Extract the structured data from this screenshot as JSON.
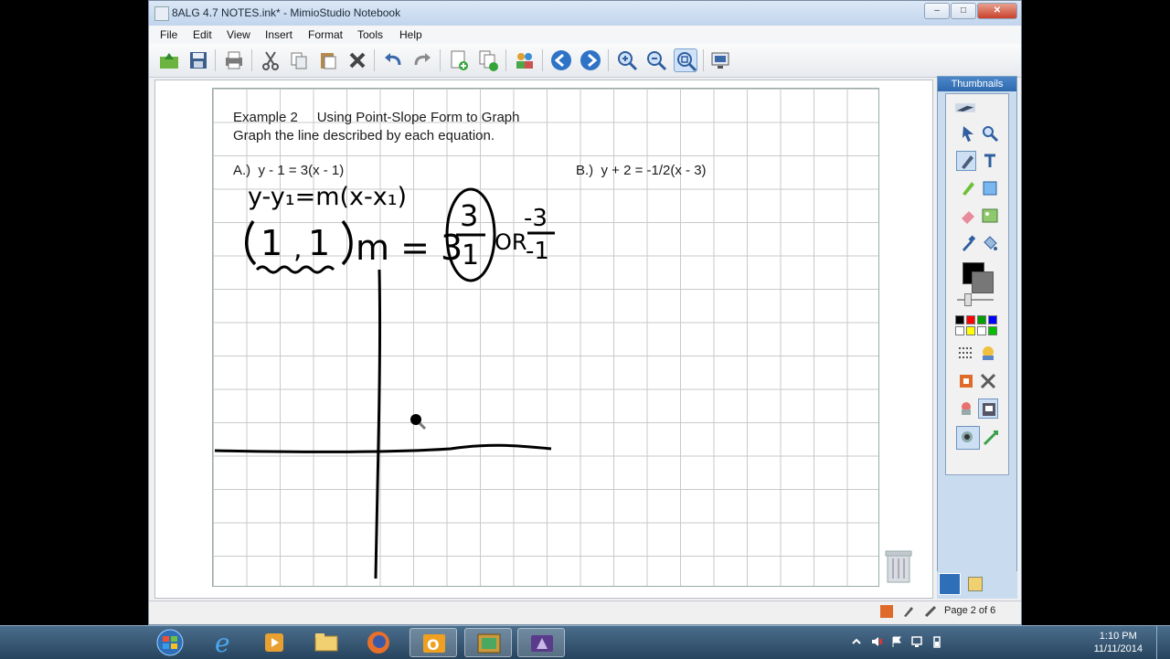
{
  "window": {
    "title": "8ALG 4.7 NOTES.ink* - MimioStudio Notebook",
    "controls": [
      "–",
      "□",
      "✕"
    ]
  },
  "menu": [
    "File",
    "Edit",
    "View",
    "Insert",
    "Format",
    "Tools",
    "Help"
  ],
  "toolbar": {
    "icons": [
      "open-icon",
      "save-icon",
      "print-icon",
      "cut-icon",
      "copy-icon",
      "paste-icon",
      "delete-icon",
      "undo-icon",
      "redo-icon",
      "new-page-icon",
      "duplicate-page-icon",
      "collaborate-icon",
      "previous-page-icon",
      "next-page-icon",
      "zoom-in-icon",
      "zoom-out-icon",
      "zoom-fit-icon",
      "display-icon"
    ],
    "active": "zoom-fit-icon"
  },
  "page": {
    "heading": "Example 2     Using Point-Slope Form to Graph",
    "instruction": "Graph the line described by each equation.",
    "problem_a": "A.)  y - 1 = 3(x - 1)",
    "problem_b": "B.)  y + 2 = -1/2(x - 3)",
    "handwriting": {
      "formula": "y-y₁=m(x-x₁)",
      "point_x": "1",
      "point_y": "1",
      "slope_label": "m = 3",
      "fraction_num": "3",
      "fraction_den": "1",
      "or_text": "OR",
      "alt_num": "-3",
      "alt_den": "-1"
    }
  },
  "side_panel": {
    "title": "Thumbnails",
    "colors": [
      "#000000",
      "#ff0000",
      "#00a000",
      "#0000ff",
      "#ffffff",
      "#ffff00",
      "#ffffff",
      "#00c000"
    ]
  },
  "status": {
    "page_indicator": "Page 2 of 6"
  },
  "taskbar": {
    "apps": [
      "start-orb",
      "internet-explorer",
      "media-player",
      "file-explorer",
      "firefox",
      "outlook",
      "picture-viewer",
      "mimio-studio"
    ],
    "time": "1:10 PM",
    "date": "11/11/2014"
  }
}
